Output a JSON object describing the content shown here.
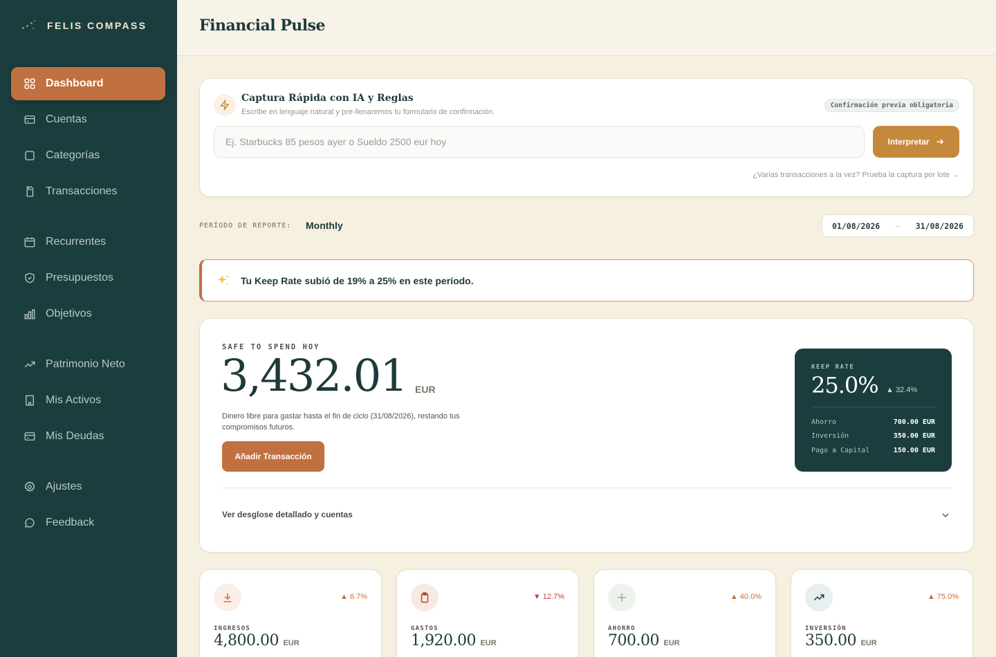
{
  "brand": {
    "name": "FELIS COMPASS"
  },
  "header": {
    "title": "Financial Pulse"
  },
  "sidebar": {
    "items": [
      {
        "label": "Dashboard",
        "icon": "dashboard-icon"
      },
      {
        "label": "Cuentas",
        "icon": "card-icon"
      },
      {
        "label": "Categorías",
        "icon": "square-icon"
      },
      {
        "label": "Transacciones",
        "icon": "receipt-icon"
      },
      {
        "label": "Recurrentes",
        "icon": "calendar-icon"
      },
      {
        "label": "Presupuestos",
        "icon": "shield-icon"
      },
      {
        "label": "Objetivos",
        "icon": "bar-chart-icon"
      },
      {
        "label": "Patrimonio Neto",
        "icon": "trend-up-icon"
      },
      {
        "label": "Mis Activos",
        "icon": "building-icon"
      },
      {
        "label": "Mis Deudas",
        "icon": "card-icon"
      },
      {
        "label": "Ajustes",
        "icon": "gear-icon"
      },
      {
        "label": "Feedback",
        "icon": "chat-icon"
      }
    ]
  },
  "quick_capture": {
    "title": "Captura Rápida con IA y Reglas",
    "subtitle": "Escribe en lenguaje natural y pre-llenaremos tu formulario de confirmación.",
    "badge": "Confirmación previa obligatoria",
    "placeholder": "Ej. Starbucks 85 pesos ayer o Sueldo 2500 eur hoy",
    "button": "Interpretar",
    "batch_link": "¿Varias transacciones a la vez? Prueba la captura por lote →"
  },
  "period": {
    "label": "PERÍODO DE REPORTE:",
    "value": "Monthly",
    "start": "01/08/2026",
    "end": "31/08/2026"
  },
  "insight": {
    "text": "Tu Keep Rate subió de 19% a 25% en este período."
  },
  "safe_to_spend": {
    "label": "SAFE TO SPEND HOY",
    "amount": "3,432.01",
    "currency": "EUR",
    "description": "Dinero libre para gastar hasta el fin de ciclo (31/08/2026), restando tus compromisos futuros.",
    "button": "Añadir Transacción",
    "toggle": "Ver desglose detallado y cuentas"
  },
  "keep_rate": {
    "label": "KEEP RATE",
    "value": "25.0%",
    "delta": "▲ 32.4%",
    "rows": [
      {
        "label": "Ahorro",
        "value": "700.00 EUR"
      },
      {
        "label": "Inversión",
        "value": "350.00 EUR"
      },
      {
        "label": "Pago a Capital",
        "value": "150.00 EUR"
      }
    ]
  },
  "stats": [
    {
      "label": "INGRESOS",
      "value": "4,800.00",
      "currency": "EUR",
      "delta": "▲ 6.7%",
      "icon": "download-icon",
      "accent": "#c1703f",
      "icon_bg": "#faeee6"
    },
    {
      "label": "GASTOS",
      "value": "1,920.00",
      "currency": "EUR",
      "delta": "▼ 12.7%",
      "icon": "clipboard-icon",
      "accent": "#b2492e",
      "icon_bg": "#f9e9e4"
    },
    {
      "label": "AHORRO",
      "value": "700.00",
      "currency": "EUR",
      "delta": "▲ 40.0%",
      "icon": "plus-icon",
      "accent": "#c1703f",
      "icon_bg": "#edf2ed"
    },
    {
      "label": "INVERSIÓN",
      "value": "350.00",
      "currency": "EUR",
      "delta": "▲ 75.0%",
      "icon": "trend-up-icon",
      "accent": "#c1703f",
      "icon_bg": "#e8efee"
    }
  ],
  "colors": {
    "sidebar_bg": "#1b3d3e",
    "accent": "#c1703f",
    "gold": "#c4893a",
    "page_bg": "#f6f0e1"
  }
}
